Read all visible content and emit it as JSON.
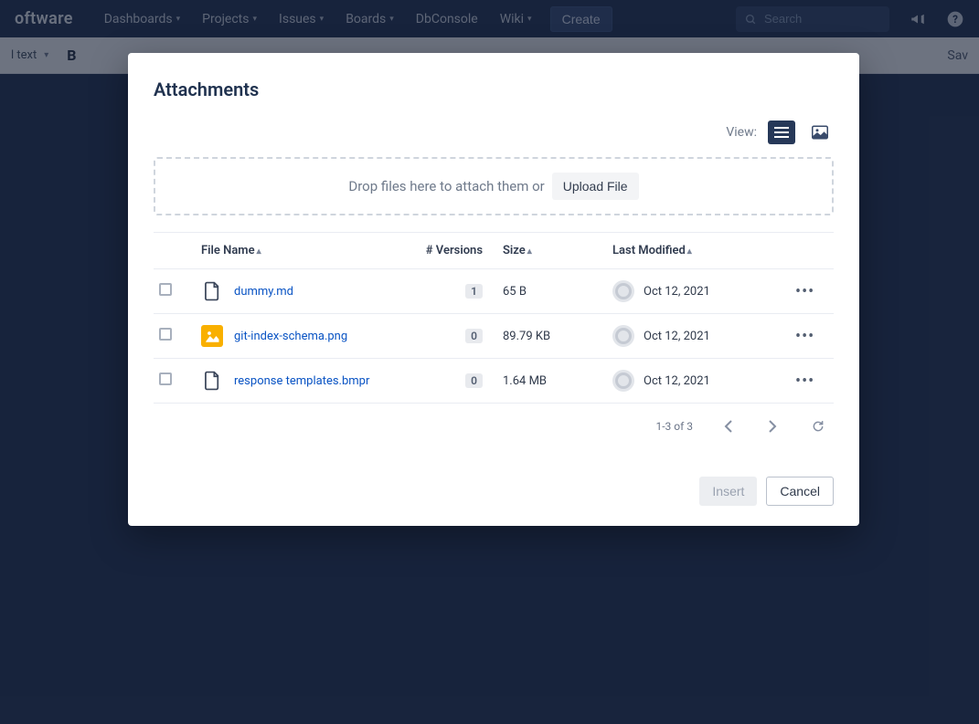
{
  "nav": {
    "brand_suffix": "oftware",
    "items": [
      "Dashboards",
      "Projects",
      "Issues",
      "Boards",
      "DbConsole",
      "Wiki"
    ],
    "create": "Create",
    "search_placeholder": "Search"
  },
  "editorbar": {
    "text_style": "l text",
    "save": "Sav"
  },
  "modal": {
    "title": "Attachments",
    "view_label": "View:",
    "drop_text": "Drop files here to attach them or",
    "upload_label": "Upload File",
    "columns": {
      "name": "File Name",
      "versions": "# Versions",
      "size": "Size",
      "modified": "Last Modified"
    },
    "rows": [
      {
        "icon": "doc",
        "name": "dummy.md",
        "versions": "1",
        "size": "65 B",
        "modified": "Oct 12, 2021"
      },
      {
        "icon": "img",
        "name": "git-index-schema.png",
        "versions": "0",
        "size": "89.79 KB",
        "modified": "Oct 12, 2021"
      },
      {
        "icon": "doc",
        "name": "response templates.bmpr",
        "versions": "0",
        "size": "1.64 MB",
        "modified": "Oct 12, 2021"
      }
    ],
    "pager": "1-3 of 3",
    "insert": "Insert",
    "cancel": "Cancel"
  }
}
